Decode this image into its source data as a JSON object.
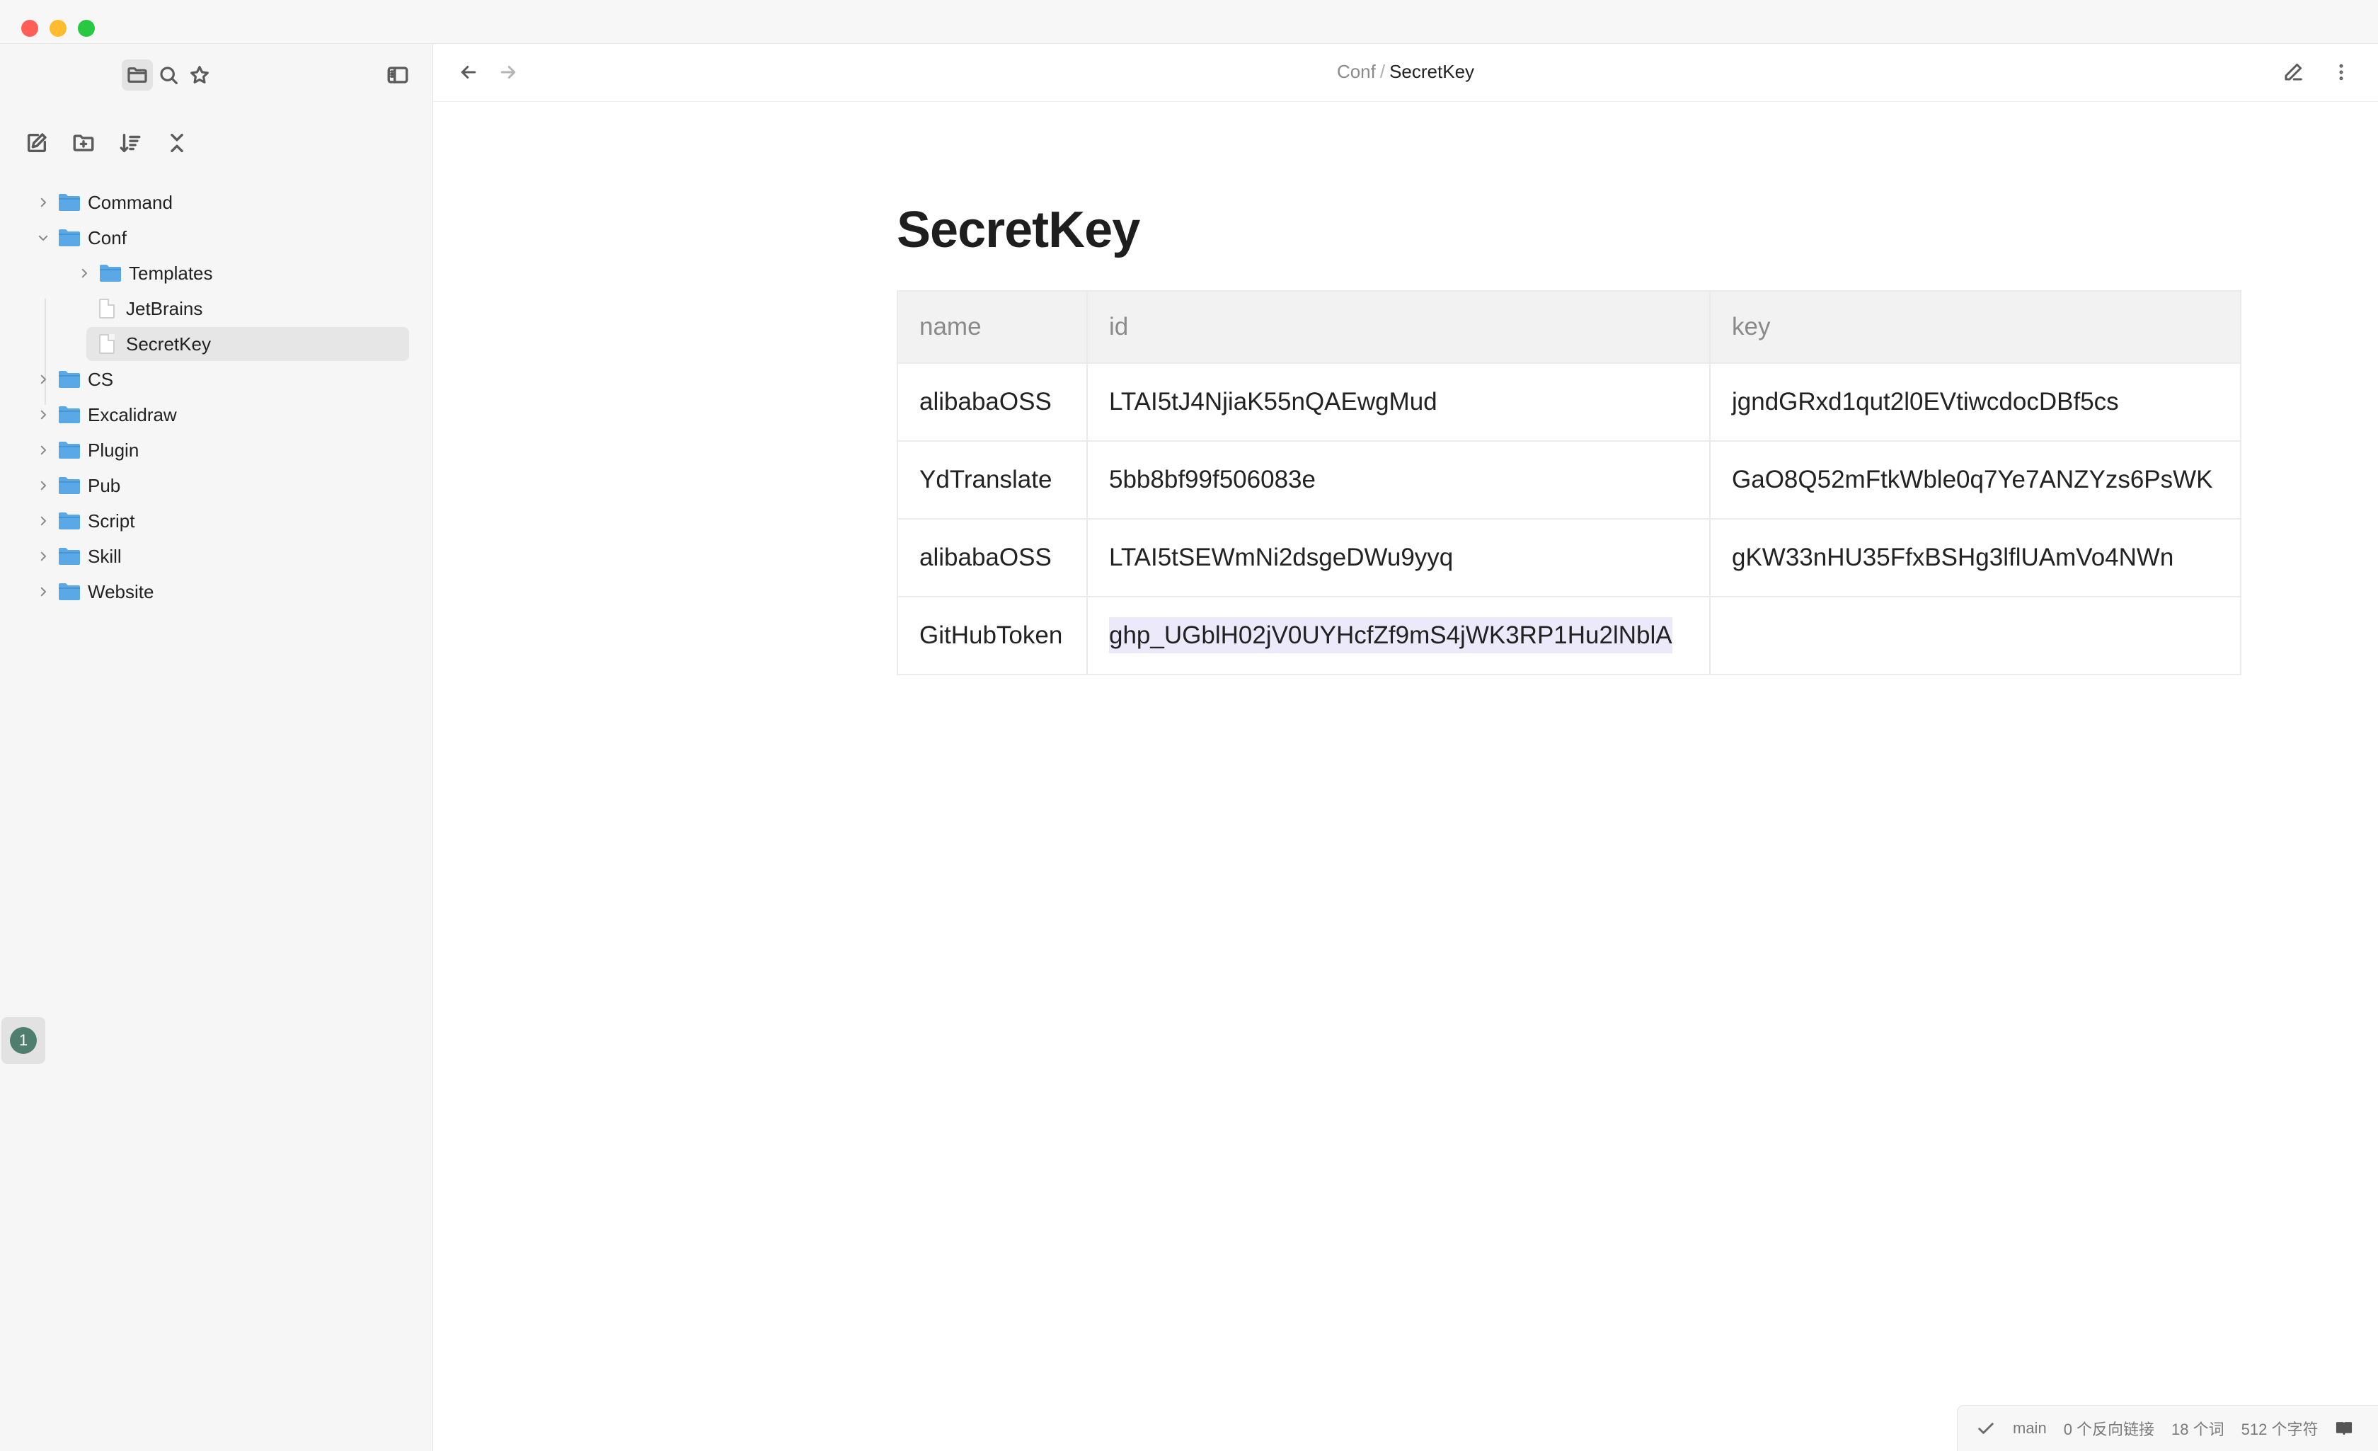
{
  "sidebar": {
    "toolbar_icons": [
      "folder-icon",
      "search-icon",
      "star-icon",
      "sidebar-toggle-icon"
    ],
    "actions": [
      "new-note-icon",
      "new-folder-icon",
      "sort-icon",
      "collapse-all-icon"
    ],
    "tree": [
      {
        "label": "Command",
        "type": "folder",
        "expanded": false
      },
      {
        "label": "Conf",
        "type": "folder",
        "expanded": true
      },
      {
        "label": "Templates",
        "type": "folder",
        "expanded": false
      },
      {
        "label": "JetBrains",
        "type": "file"
      },
      {
        "label": "SecretKey",
        "type": "file",
        "selected": true
      },
      {
        "label": "CS",
        "type": "folder",
        "expanded": false
      },
      {
        "label": "Excalidraw",
        "type": "folder",
        "expanded": false
      },
      {
        "label": "Plugin",
        "type": "folder",
        "expanded": false
      },
      {
        "label": "Pub",
        "type": "folder",
        "expanded": false
      },
      {
        "label": "Script",
        "type": "folder",
        "expanded": false
      },
      {
        "label": "Skill",
        "type": "folder",
        "expanded": false
      },
      {
        "label": "Website",
        "type": "folder",
        "expanded": false
      }
    ],
    "badge": "1"
  },
  "header": {
    "breadcrumb_parent": "Conf",
    "breadcrumb_sep": "/",
    "breadcrumb_current": "SecretKey"
  },
  "document": {
    "title": "SecretKey",
    "table": {
      "headers": [
        "name",
        "id",
        "key"
      ],
      "rows": [
        [
          "alibabaOSS",
          "LTAI5tJ4NjiaK55nQAEwgMud",
          "jgndGRxd1qut2l0EVtiwcdocDBf5cs"
        ],
        [
          "YdTranslate",
          "5bb8bf99f506083e",
          "GaO8Q52mFtkWble0q7Ye7ANZYzs6PsWK"
        ],
        [
          "alibabaOSS",
          "LTAI5tSEWmNi2dsgeDWu9yyq",
          "gKW33nHU35FfxBSHg3lflUAmVo4NWn"
        ],
        [
          "GitHubToken",
          "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",
          ""
        ]
      ]
    }
  },
  "statusbar": {
    "branch": "main",
    "backlinks": "0 个反向链接",
    "words": "18 个词",
    "chars": "512 个字符"
  },
  "colors": {
    "folder": "#5aa9e6",
    "highlight": "#ece9fb",
    "badge": "#4f7d6e"
  }
}
